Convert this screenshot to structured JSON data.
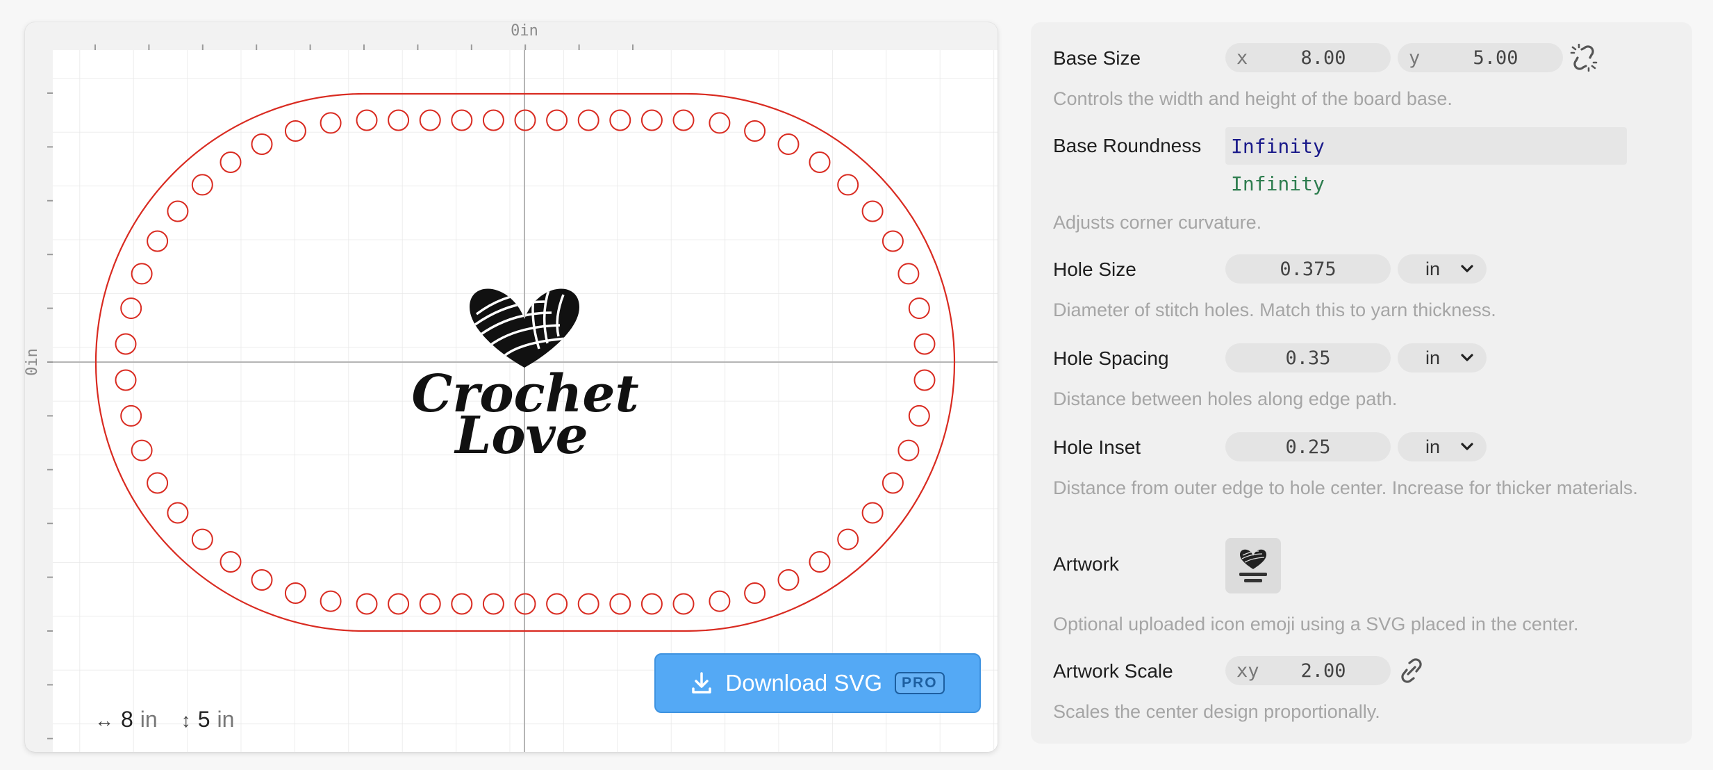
{
  "canvas": {
    "x_axis_label": "0in",
    "y_axis_label": "0in",
    "artwork_text_line1": "Crochet",
    "artwork_text_line2": "Love",
    "board_outline_color": "#d92b21",
    "hole_color": "#d92b21",
    "dimensions": {
      "width_value": "8",
      "width_unit": "in",
      "height_value": "5",
      "height_unit": "in"
    },
    "download_button": {
      "label": "Download SVG",
      "badge": "PRO",
      "color": "#54a9f5"
    }
  },
  "settings": {
    "base_size": {
      "label": "Base Size",
      "x_prefix": "x",
      "x_value": "8.00",
      "y_prefix": "y",
      "y_value": "5.00",
      "lock_icon": "unlink-icon",
      "description": "Controls the width and height of the board base."
    },
    "base_roundness": {
      "label": "Base Roundness",
      "value": "Infinity",
      "evaluated": "Infinity",
      "description": "Adjusts corner curvature."
    },
    "hole_size": {
      "label": "Hole Size",
      "value": "0.375",
      "unit": "in",
      "description": "Diameter of stitch holes. Match this to yarn thickness."
    },
    "hole_spacing": {
      "label": "Hole Spacing",
      "value": "0.35",
      "unit": "in",
      "description": "Distance between holes along edge path."
    },
    "hole_inset": {
      "label": "Hole Inset",
      "value": "0.25",
      "unit": "in",
      "description": "Distance from outer edge to hole center. Increase for thicker materials."
    },
    "artwork": {
      "label": "Artwork",
      "description": "Optional uploaded icon emoji using a SVG placed in the center."
    },
    "artwork_scale": {
      "label": "Artwork Scale",
      "prefix": "xy",
      "value": "2.00",
      "lock_icon": "link-icon",
      "description": "Scales the center design proportionally."
    }
  }
}
